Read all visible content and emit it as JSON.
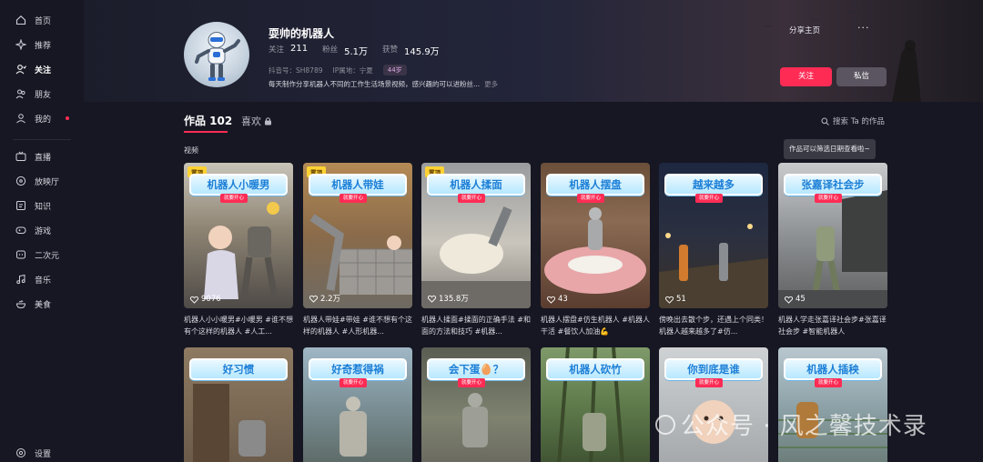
{
  "sidebar": {
    "items": [
      {
        "label": "首页",
        "icon": "home-icon"
      },
      {
        "label": "推荐",
        "icon": "sparkle-icon"
      },
      {
        "label": "关注",
        "icon": "follow-icon"
      },
      {
        "label": "朋友",
        "icon": "friends-icon"
      },
      {
        "label": "我的",
        "icon": "user-icon"
      },
      {
        "label": "直播",
        "icon": "live-icon"
      },
      {
        "label": "放映厅",
        "icon": "cinema-icon"
      },
      {
        "label": "知识",
        "icon": "knowledge-icon"
      },
      {
        "label": "游戏",
        "icon": "game-icon"
      },
      {
        "label": "二次元",
        "icon": "anime-icon"
      },
      {
        "label": "音乐",
        "icon": "music-icon"
      },
      {
        "label": "美食",
        "icon": "food-icon"
      }
    ],
    "settings": "设置"
  },
  "profile": {
    "name": "耍帅的机器人",
    "following_label": "关注",
    "following": "211",
    "fans_label": "粉丝",
    "fans": "5.1万",
    "likes_label": "获赞",
    "likes": "145.9万",
    "douyin_id": "抖音号：SH8789",
    "ip": "IP属地：宁夏",
    "age": "44岁",
    "bio": "每天制作分享机器人不同的工作生活场景视频，感兴趣的可以进粉丝...",
    "more": "更多",
    "share": "分享主页",
    "more_menu": "···",
    "follow_btn": "关注",
    "message_btn": "私信"
  },
  "tabs": {
    "works_label": "作品 102",
    "likes_label": "喜欢",
    "search": "搜索 Ta 的作品",
    "section": "视频",
    "tooltip": "作品可以筛选日期查看啦~"
  },
  "colors": {
    "accent": "#fe2c55",
    "background": "#161722"
  },
  "videos": [
    {
      "title": "机器人小暖男",
      "sub": "就要开心",
      "pinned": "置顶",
      "likes": "9076",
      "desc": "机器人小小暖男#小暖男 #谁不想有个这样的机器人 #人工..."
    },
    {
      "title": "机器人带娃",
      "sub": "就要开心",
      "pinned": "置顶",
      "likes": "2.2万",
      "desc": "机器人带娃#带娃 #谁不想有个这样的机器人 #人形机器..."
    },
    {
      "title": "机器人揉面",
      "sub": "就要开心",
      "pinned": "置顶",
      "likes": "135.8万",
      "desc": "机器人揉面#揉面的正确手法 #和面的方法和技巧 #机器..."
    },
    {
      "title": "机器人摆盘",
      "sub": "就要开心",
      "pinned": "",
      "likes": "43",
      "desc": "机器人摆盘#仿生机器人 #机器人干活 #餐饮人加油💪"
    },
    {
      "title": "越来越多",
      "sub": "就要开心",
      "pinned": "",
      "likes": "51",
      "desc": "傍晚出去散个步，还遇上个同类！机器人越来越多了#仿..."
    },
    {
      "title": "张嘉译社会步",
      "sub": "就要开心",
      "pinned": "",
      "likes": "45",
      "desc": "机器人学走张嘉译社会步#张嘉译社会步 #智能机器人"
    },
    {
      "title": "好习惯",
      "sub": "",
      "pinned": "",
      "likes": "",
      "desc": ""
    },
    {
      "title": "好奇惹得祸",
      "sub": "就要开心",
      "pinned": "",
      "likes": "",
      "desc": ""
    },
    {
      "title": "会下蛋🥚？",
      "sub": "就要开心",
      "pinned": "",
      "likes": "",
      "desc": ""
    },
    {
      "title": "机器人砍竹",
      "sub": "",
      "pinned": "",
      "likes": "",
      "desc": ""
    },
    {
      "title": "你到底是谁",
      "sub": "就要开心",
      "pinned": "",
      "likes": "",
      "desc": ""
    },
    {
      "title": "机器人插秧",
      "sub": "就要开心",
      "pinned": "",
      "likes": "",
      "desc": ""
    }
  ],
  "watermark": "公众号 · 风之馨技术录"
}
